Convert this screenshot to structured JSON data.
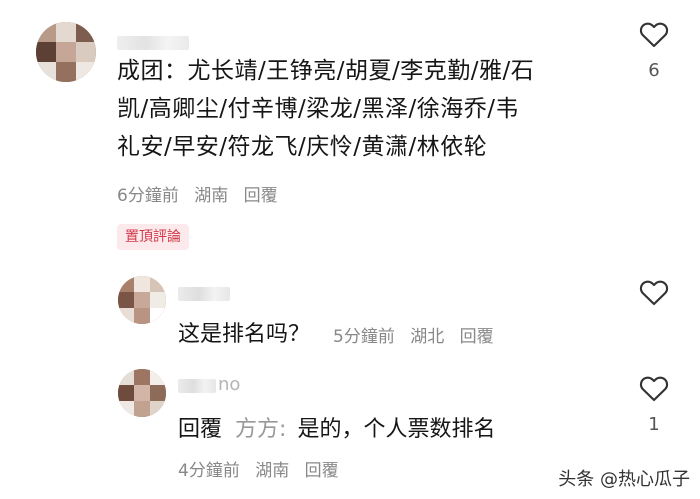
{
  "comments": [
    {
      "author": "",
      "lines": [
        "成团：尤长靖/王铮亮/胡夏/李克勤/雅/石",
        "凯/高卿尘/付辛博/梁龙/黑泽/徐海乔/韦",
        "礼安/早安/符龙飞/庆怜/黄潇/林依轮"
      ],
      "time": "6分鐘前",
      "location": "湖南",
      "reply_label": "回覆",
      "pin_label": "置頂評論",
      "like_count": "6"
    }
  ],
  "replies": [
    {
      "author": "",
      "text": "这是排名吗？",
      "time": "5分鐘前",
      "location": "湖北",
      "reply_label": "回覆",
      "like_count": ""
    },
    {
      "author_suffix": "no",
      "reply_prefix": "回覆",
      "reply_target": "方方:",
      "text": "是的，个人票数排名",
      "time": "4分鐘前",
      "location": "湖南",
      "reply_label": "回覆",
      "like_count": "1"
    }
  ],
  "watermark": "头条 @热心瓜子",
  "colors": {
    "pin": "#d23a4b",
    "pin_bg": "#fbe9eb",
    "meta": "#888888"
  }
}
